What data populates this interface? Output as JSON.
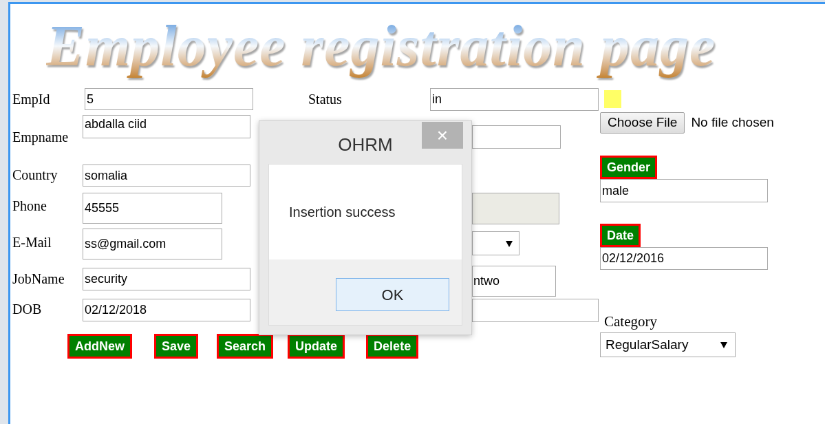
{
  "title": "Employee registration page",
  "left_fields": [
    {
      "label": "EmpId",
      "value": "5"
    },
    {
      "label": "Empname",
      "value": "abdalla ciid"
    },
    {
      "label": "Country",
      "value": "somalia"
    },
    {
      "label": "Phone",
      "value": "45555"
    },
    {
      "label": "E-Mail",
      "value": "ss@gmail.com"
    },
    {
      "label": "JobName",
      "value": "security"
    },
    {
      "label": "DOB",
      "value": "02/12/2018"
    }
  ],
  "buttons": [
    "AddNew",
    "Save",
    "Search",
    "Update",
    "Delete"
  ],
  "status": {
    "label": "Status",
    "value": "in"
  },
  "middle_fields": [
    {
      "kind": "text"
    },
    {
      "kind": "disabled"
    },
    {
      "kind": "select"
    },
    {
      "kind": "text",
      "value": "ntwo"
    },
    {
      "kind": "text"
    }
  ],
  "file": {
    "button": "Choose File",
    "status": "No file chosen"
  },
  "gender": {
    "label": "Gender",
    "value": "male"
  },
  "date": {
    "label": "Date",
    "value": "02/12/2016"
  },
  "category": {
    "label": "Category",
    "value": "RegularSalary"
  },
  "dialog": {
    "title": "OHRM",
    "close": "×",
    "message": "Insertion success",
    "button": "OK"
  }
}
